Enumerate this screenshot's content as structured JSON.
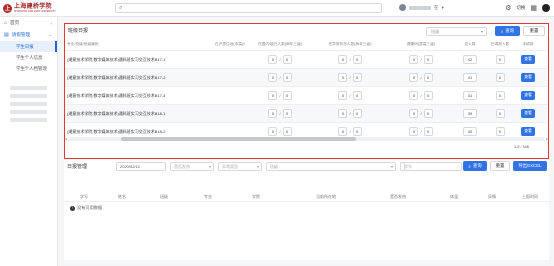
{
  "app": {
    "logo_mark": "上",
    "logo_text": "上海建桥学院",
    "logo_sub": "SHANGHAI JIAN QIAO UNIVERSITY",
    "user_suffix": "在",
    "user_caret": "▾",
    "settings_label": "切换",
    "lang_label": "",
    "colors": {
      "accent": "#2f73e6",
      "highlight": "#e5373b",
      "brand": "#9b1f1f"
    }
  },
  "sidebar": {
    "home": "首页",
    "group": "请假管理",
    "items": [
      "学生日报",
      "学生个人信息",
      "学生个人档管理"
    ]
  },
  "panel1": {
    "title": "班级日报",
    "select_placeholder": "班级",
    "search_label": "查询",
    "reset_label": "重置",
    "headers": [
      "专业/班级/班级编码",
      "应入数",
      "确认入数",
      "同学人数/离校人数",
      "在沪居住地(非高)/中(情况)(暂住三级)",
      "在国内/境外人数(两年三级)",
      "在异常状态人数(两年三级)",
      "健康码(居高三级)",
      "总人数",
      "已填报人数",
      "本填报"
    ],
    "rows": [
      {
        "name": "(湘意技术学院,数字媒体技术)通科班实习交互技术B17-1",
        "a": "0",
        "b": "0",
        "c": "0",
        "d": "0",
        "e": "0",
        "f": "0",
        "total": "42",
        "filled": "0"
      },
      {
        "name": "(湘意技术学院,数字媒体技术)通科班实习交互技术B17-2",
        "a": "0",
        "b": "0",
        "c": "0",
        "d": "0",
        "e": "0",
        "f": "0",
        "total": "41",
        "filled": "0"
      },
      {
        "name": "(湘意技术学院,数字媒体技术)通科班实习交互技术B17-4",
        "a": "0",
        "b": "0",
        "c": "0",
        "d": "0",
        "e": "0",
        "f": "0",
        "total": "41",
        "filled": "0"
      },
      {
        "name": "(湘意技术学院,数字媒体技术)通科班实习交互技术B18-1",
        "a": "0",
        "b": "0",
        "c": "0",
        "d": "0",
        "e": "0",
        "f": "0",
        "total": "39",
        "filled": "0"
      },
      {
        "name": "(湘意技术学院,数字媒体技术)通科班实习交互技术B18-2",
        "a": "0",
        "b": "0",
        "c": "0",
        "d": "0",
        "e": "0",
        "f": "0",
        "total": "40",
        "filled": "0"
      }
    ],
    "view_label": "查看",
    "pager": "1-5 / 546"
  },
  "panel2": {
    "title": "日报管理",
    "date": "2020/02/12",
    "select1": "是否发热",
    "select2": "异常类型",
    "select3": "班级",
    "input_student_no": "学号",
    "input_name": "姓名",
    "search_label": "查询",
    "reset_label": "重置",
    "export_label": "导出EXCEL",
    "headers": [
      "学号",
      "姓名",
      "班级",
      "专业",
      "学院",
      "当前所在地",
      "是否发热",
      "体温",
      "异情",
      "上报时间"
    ],
    "empty_text": "没有可用数据"
  }
}
